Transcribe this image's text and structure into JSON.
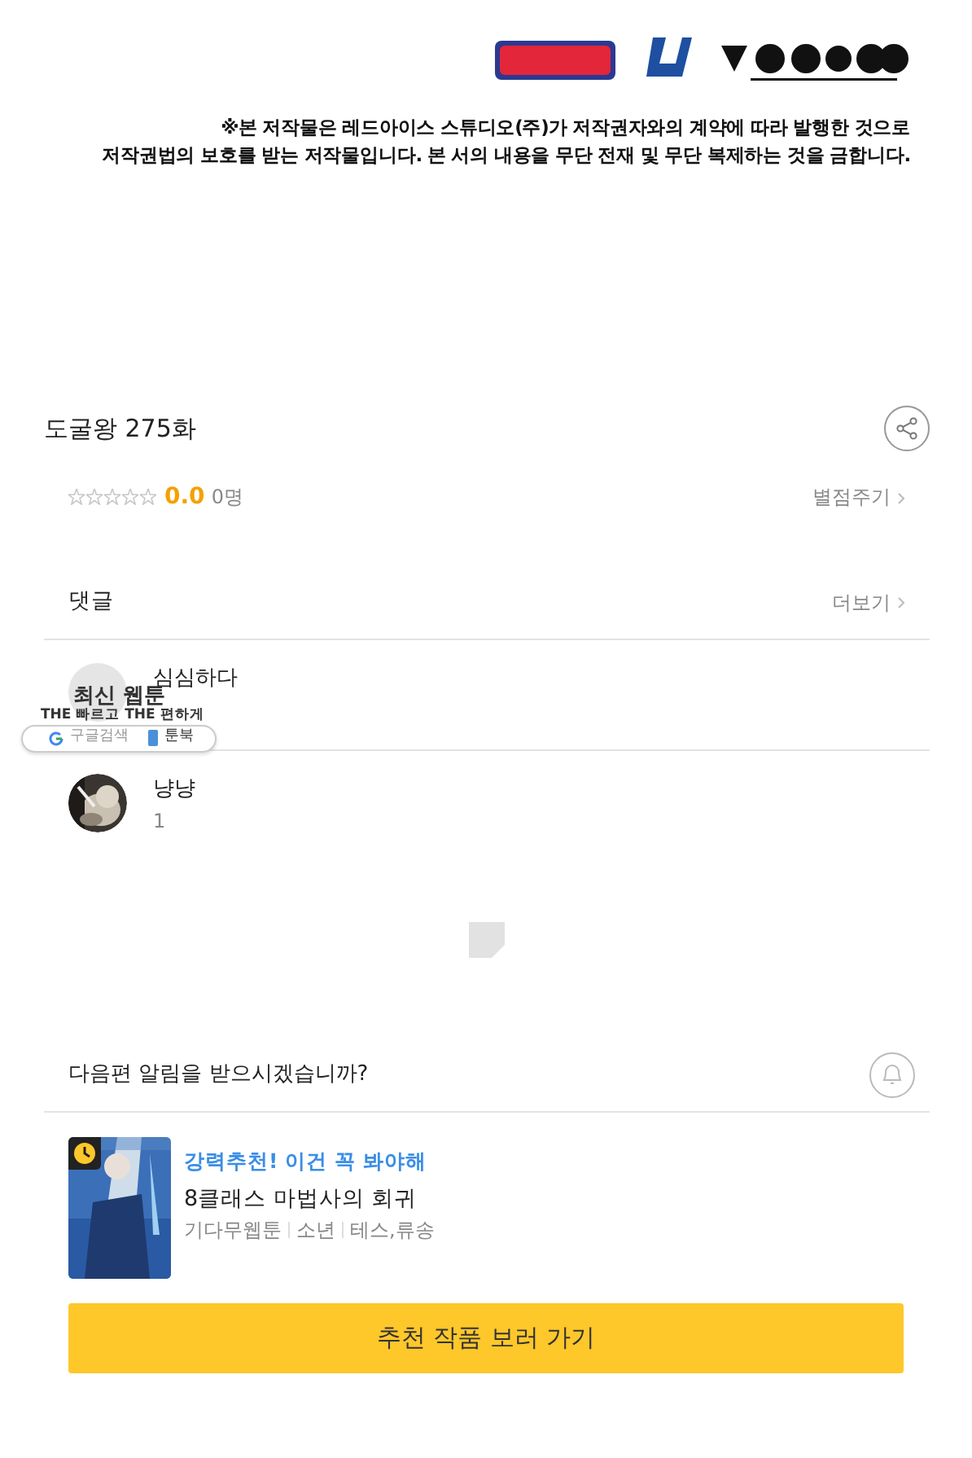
{
  "copyright_notice": [
    "※본 저작물은 레드아이스 스튜디오(주)가 저작권자와의 계약에 따라 발행한 것으로",
    "저작권법의 보호를 받는 저작물입니다. 본 서의 내용을 무단 전재 및 무단 복제하는 것을 금합니다."
  ],
  "episode": {
    "title": "도굴왕 275화"
  },
  "rating": {
    "stars": 0,
    "score": "0.0",
    "count": "0명",
    "action": "별점주기"
  },
  "comments": {
    "title": "댓글",
    "more": "더보기",
    "items": [
      {
        "author": "심심하다",
        "kind": "placeholder"
      },
      {
        "author": "냥냥",
        "text": "1",
        "kind": "picture"
      }
    ]
  },
  "ad": {
    "headline": "최신 웹툰",
    "tagline": "THE 빠르고 THE 편하게",
    "links": [
      "구글검색",
      "툰북"
    ]
  },
  "notification": {
    "question": "다음편 알림을 받으시겠습니까?",
    "on": false
  },
  "recommendation": {
    "tag": "강력추천! 이건 꼭 봐야해",
    "title": "8클래스 마법사의 회귀",
    "meta": [
      "기다무웹툰",
      "소년",
      "테스,류송"
    ],
    "button": "추천 작품 보러 가기"
  }
}
